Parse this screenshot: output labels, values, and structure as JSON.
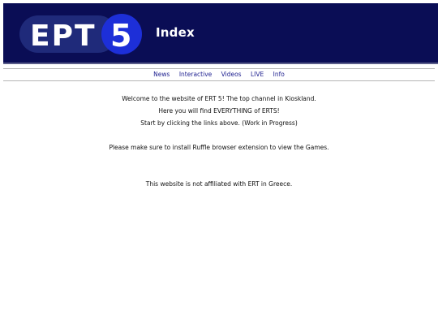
{
  "header": {
    "logo_text": "EPT",
    "logo_number": "5",
    "page_title": "Index"
  },
  "nav": {
    "items": [
      {
        "label": "News"
      },
      {
        "label": "Interactive"
      },
      {
        "label": "Videos"
      },
      {
        "label": "LIVE"
      },
      {
        "label": "Info"
      }
    ]
  },
  "content": {
    "welcome": "Welcome to the website of ERT 5! The top channel in Kioskland.",
    "everything": "Here you will find EVERYTHING of ERTS!",
    "start": "Start by clicking the links above. (Work in Progress)",
    "ruffle": "Please make sure to install Ruffle browser extension to view the Games.",
    "disclaimer": "This website is not affiliated with ERT in Greece."
  },
  "colors": {
    "header_bg": "#0a0d55",
    "logo_pill": "#1f2a7a",
    "logo_circle": "#1d2fd8",
    "link": "#1d1f8f"
  }
}
